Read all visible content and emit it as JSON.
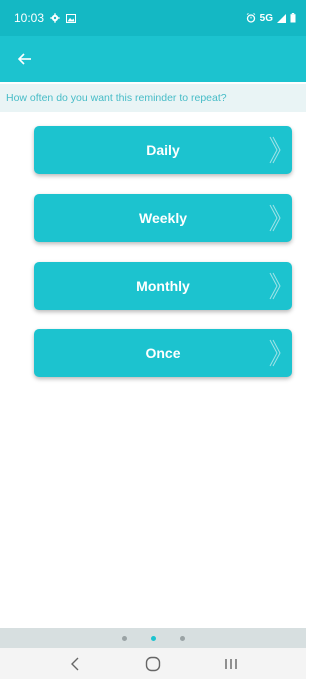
{
  "status_bar": {
    "time": "10:03",
    "network": "5G",
    "icons": [
      "settings-gear-icon",
      "image-icon",
      "alarm-icon",
      "signal-icon",
      "battery-icon"
    ]
  },
  "app_bar": {
    "back_icon": "arrow-left-icon"
  },
  "prompt": "How often do you want this reminder to repeat?",
  "options": [
    {
      "label": "Daily"
    },
    {
      "label": "Weekly"
    },
    {
      "label": "Monthly"
    },
    {
      "label": "Once"
    }
  ],
  "pager": {
    "pages": 3,
    "active_index": 1
  },
  "nav_bar": {
    "icons": [
      "back-chevron-icon",
      "home-circle-icon",
      "recents-icon"
    ]
  },
  "colors": {
    "accent": "#1cc3cf",
    "status": "#14b8c4",
    "prompt_bg": "#e9f4f5",
    "prompt_text": "#47bcc7"
  }
}
